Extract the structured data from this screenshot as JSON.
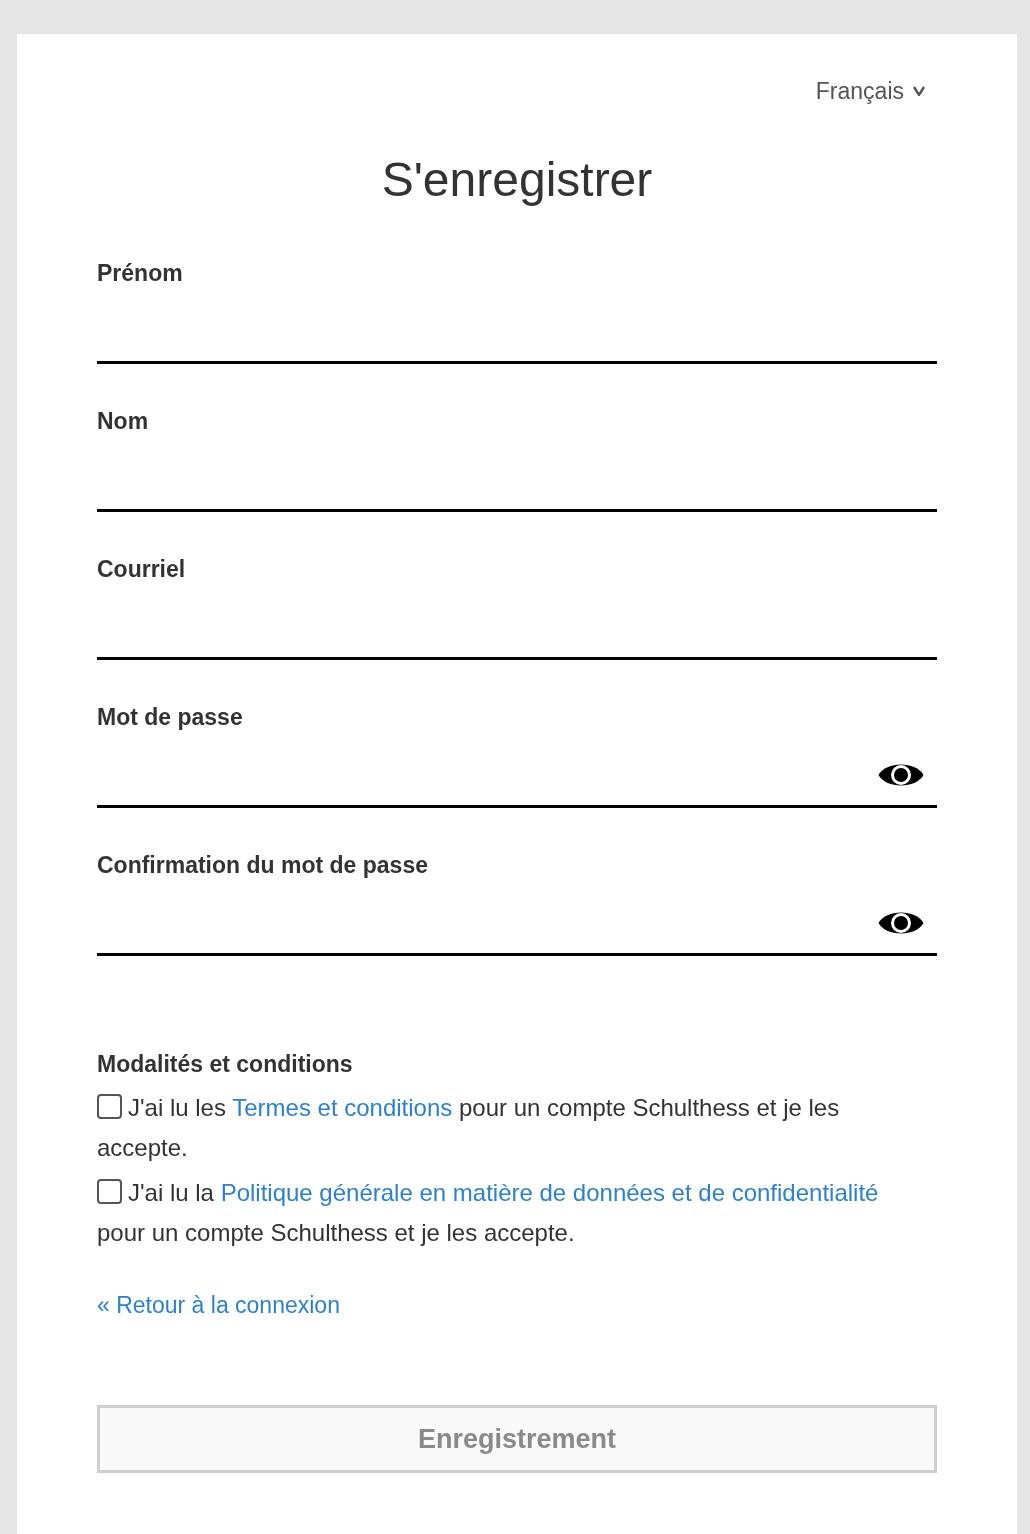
{
  "language": {
    "label": "Français"
  },
  "title": "S'enregistrer",
  "fields": [
    {
      "label": "Prénom",
      "kind": "text"
    },
    {
      "label": "Nom",
      "kind": "text"
    },
    {
      "label": "Courriel",
      "kind": "email"
    },
    {
      "label": "Mot de passe",
      "kind": "password"
    },
    {
      "label": "Confirmation du mot de passe",
      "kind": "password"
    }
  ],
  "terms": {
    "heading": "Modalités et conditions",
    "items": [
      {
        "before": "J'ai lu les ",
        "link": "Termes et conditions",
        "after": " pour un compte Schulthess et je les accepte.",
        "checked": false
      },
      {
        "before": "J'ai lu la ",
        "link": "Politique générale en matière de données et de confidentialité",
        "after": " pour un compte Schulthess et je les accepte.",
        "checked": false
      }
    ]
  },
  "back_link": "« Retour à la connexion",
  "submit": {
    "label": "Enregistrement",
    "disabled": true
  }
}
